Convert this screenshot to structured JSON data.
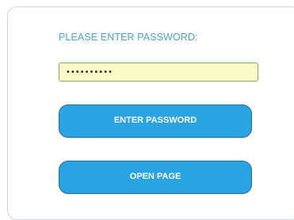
{
  "login": {
    "prompt": "PLEASE ENTER PASSWORD:",
    "password_value": "••••••••••",
    "enter_button_label": "ENTER PASSWORD",
    "open_button_label": "OPEN PAGE"
  },
  "colors": {
    "accent": "#29a3e1",
    "prompt_text": "#4aa3d6",
    "field_background": "#fbfbc7",
    "field_border": "#88aa55",
    "panel_border": "#cfd8de"
  }
}
